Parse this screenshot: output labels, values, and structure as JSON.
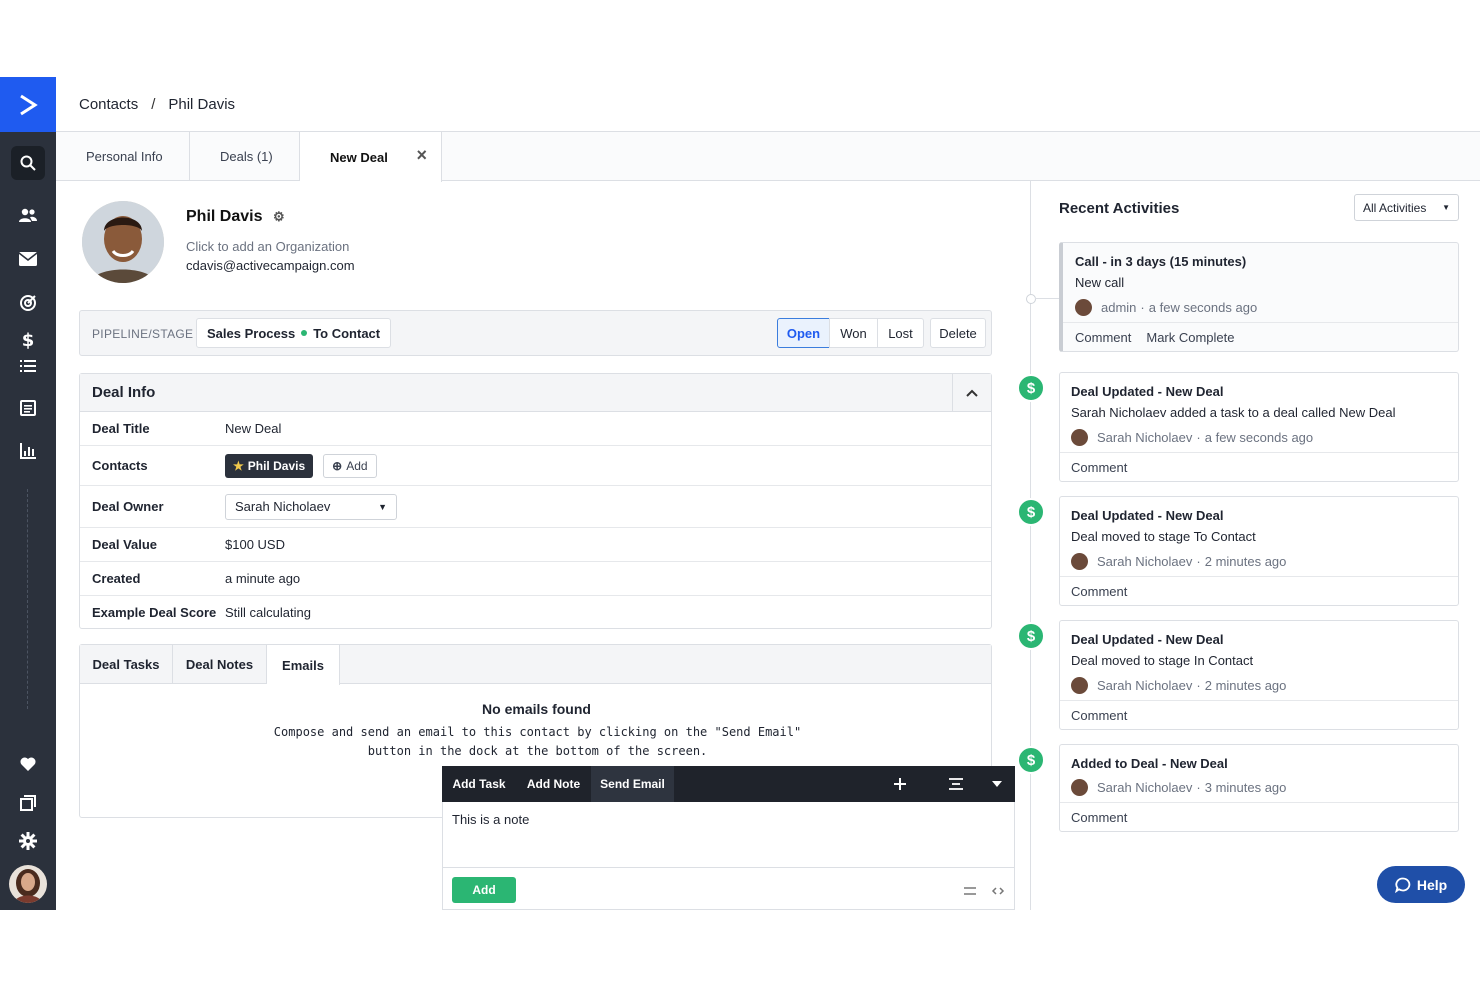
{
  "breadcrumb": {
    "root": "Contacts",
    "separator": "/",
    "current": "Phil Davis"
  },
  "tabs": [
    {
      "label": "Personal Info"
    },
    {
      "label": "Deals (1)"
    },
    {
      "label": "New Deal",
      "close": "×"
    }
  ],
  "contact": {
    "name": "Phil Davis",
    "org_placeholder": "Click to add an Organization",
    "email": "cdavis@activecampaign.com"
  },
  "pipeline": {
    "label": "PIPELINE/STAGE",
    "pipeline_name": "Sales Process",
    "stage_name": "To Contact",
    "stage_color": "#2bb673",
    "buttons": {
      "open": "Open",
      "won": "Won",
      "lost": "Lost",
      "delete": "Delete"
    }
  },
  "deal_info": {
    "title": "Deal Info",
    "rows": {
      "title_label": "Deal Title",
      "title_value": "New Deal",
      "contacts_label": "Contacts",
      "contact_chip": "Phil Davis",
      "add_label": "Add",
      "owner_label": "Deal Owner",
      "owner_value": "Sarah Nicholaev",
      "value_label": "Deal Value",
      "value_value": "$100 USD",
      "created_label": "Created",
      "created_value": "a minute ago",
      "score_label": "Example Deal Score",
      "score_value": "Still calculating"
    }
  },
  "bottom_tabs": {
    "tasks": "Deal Tasks",
    "notes": "Deal Notes",
    "emails": "Emails",
    "empty_title": "No emails found",
    "empty_text": "Compose and send an email to this contact by clicking on the \"Send Email\" button in the dock at the bottom of the screen."
  },
  "dock": {
    "add_task": "Add Task",
    "add_note": "Add Note",
    "send_email": "Send Email",
    "note_text": "This is a note",
    "add_button": "Add"
  },
  "activities": {
    "title": "Recent Activities",
    "filter": "All Activities",
    "items": [
      {
        "title": "Call - in 3 days (15 minutes)",
        "desc": "New call",
        "user": "admin",
        "time": "a few seconds ago",
        "actions": [
          "Comment",
          "Mark Complete"
        ]
      },
      {
        "title": "Deal Updated - New Deal",
        "desc": "Sarah Nicholaev added a task to a deal called New Deal",
        "user": "Sarah Nicholaev",
        "time": "a few seconds ago",
        "actions": [
          "Comment"
        ]
      },
      {
        "title": "Deal Updated - New Deal",
        "desc": "Deal moved to stage To Contact",
        "user": "Sarah Nicholaev",
        "time": "2 minutes ago",
        "actions": [
          "Comment"
        ]
      },
      {
        "title": "Deal Updated - New Deal",
        "desc": "Deal moved to stage In Contact",
        "user": "Sarah Nicholaev",
        "time": "2 minutes ago",
        "actions": [
          "Comment"
        ]
      },
      {
        "title": "Added to Deal - New Deal",
        "desc": "",
        "user": "Sarah Nicholaev",
        "time": "3 minutes ago",
        "actions": [
          "Comment"
        ]
      }
    ]
  },
  "help": {
    "label": "Help"
  },
  "colors": {
    "brand": "#1f5bf0",
    "sidebar": "#2b313c",
    "success": "#2bb673",
    "help": "#1f4fa8"
  }
}
